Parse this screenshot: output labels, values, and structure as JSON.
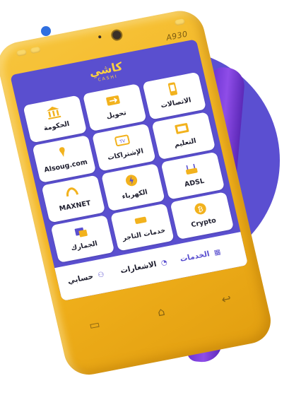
{
  "device": {
    "model": "A930"
  },
  "app": {
    "logo_text": "كاشي",
    "logo_sub": "CASHI"
  },
  "services": [
    {
      "label": "الاتصالات",
      "icon": "telecom-icon"
    },
    {
      "label": "تحويل",
      "icon": "transfer-icon"
    },
    {
      "label": "الحكومة",
      "icon": "government-icon"
    },
    {
      "label": "التعليم",
      "icon": "education-icon"
    },
    {
      "label": "الإشتراكات",
      "icon": "tv-subscriptions-icon"
    },
    {
      "label": "Alsoug.com",
      "icon": "alsoug-icon"
    },
    {
      "label": "ADSL",
      "icon": "router-icon"
    },
    {
      "label": "الكهرباء",
      "icon": "electricity-icon"
    },
    {
      "label": "MAXNET",
      "icon": "maxnet-icon"
    },
    {
      "label": "Crypto",
      "icon": "bitcoin-icon"
    },
    {
      "label": "خدمات التاجر",
      "icon": "cashi-merchant-icon"
    },
    {
      "label": "الجمارك",
      "icon": "customs-icon"
    }
  ],
  "nav": {
    "services": "الخدمات",
    "notifications": "الاشعارات",
    "account": "حسابي"
  },
  "colors": {
    "brand_purple": "#5a4fcf",
    "device_yellow": "#f2b21d",
    "logo_yellow": "#ffd23f",
    "handle_purple": "#7b3fe0"
  }
}
